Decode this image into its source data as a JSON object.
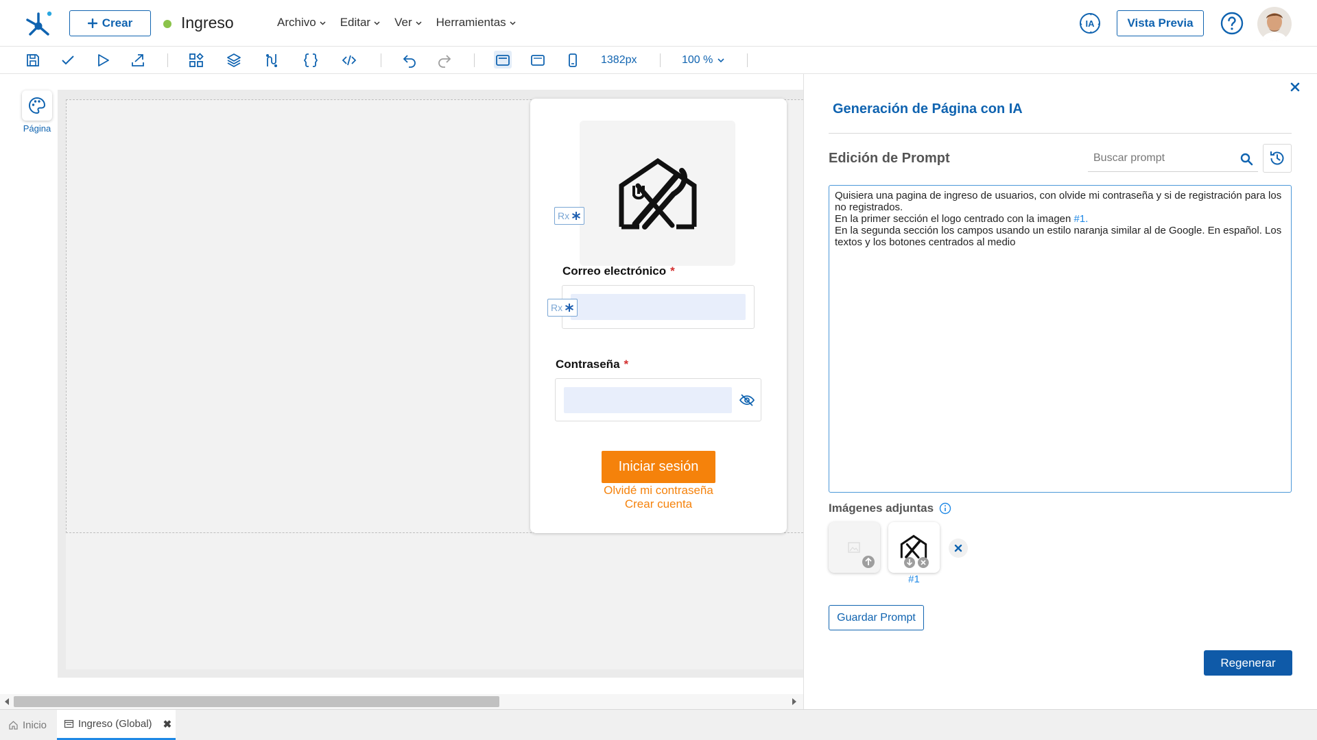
{
  "header": {
    "create_label": "Crear",
    "doc_title": "Ingreso",
    "menus": [
      {
        "label": "Archivo"
      },
      {
        "label": "Editar"
      },
      {
        "label": "Ver"
      },
      {
        "label": "Herramientas"
      }
    ],
    "ia_label": "IA",
    "preview_label": "Vista Previa",
    "accent_color": "#0f63b0",
    "status_color": "#8bc34a"
  },
  "toolbar": {
    "icons": [
      "save-icon",
      "check-icon",
      "run-icon",
      "publish-icon",
      "components-icon",
      "layers-icon",
      "flow-icon",
      "braces-icon",
      "code-icon",
      "undo-icon",
      "redo-icon",
      "desktop-icon",
      "tablet-icon",
      "mobile-icon"
    ],
    "width_value": "1382px",
    "zoom_value": "100 %"
  },
  "rail": {
    "page_label": "Página"
  },
  "canvas": {
    "rx_label": "Rx",
    "email_label": "Correo electrónico",
    "required_mark": "*",
    "password_label": "Contraseña",
    "login_button": "Iniciar sesión",
    "forgot_link": "Olvidé mi contraseña",
    "create_account_link": "Crear cuenta",
    "button_color": "#f5820b"
  },
  "panel": {
    "title": "Generación de Página con IA",
    "section_title": "Edición de Prompt",
    "search_placeholder": "Buscar prompt",
    "prompt_before_ref": "Quisiera una pagina de ingreso de usuarios, con olvide mi contraseña y si de registración para los no registrados.",
    "prompt_line2_before": "En la primer sección el logo centrado con la imagen ",
    "prompt_ref": "#1",
    "prompt_line2_after": ".",
    "prompt_line3": "En la segunda sección los campos usando un estilo naranja similar al de Google. En español. Los textos y los botones centrados al medio",
    "images_title": "Imágenes adjuntas",
    "image_caption": "#1",
    "save_prompt_label": "Guardar Prompt",
    "regenerate_label": "Regenerar"
  },
  "tabs": {
    "home_label": "Inicio",
    "doc_tab_label": "Ingreso (Global)"
  }
}
